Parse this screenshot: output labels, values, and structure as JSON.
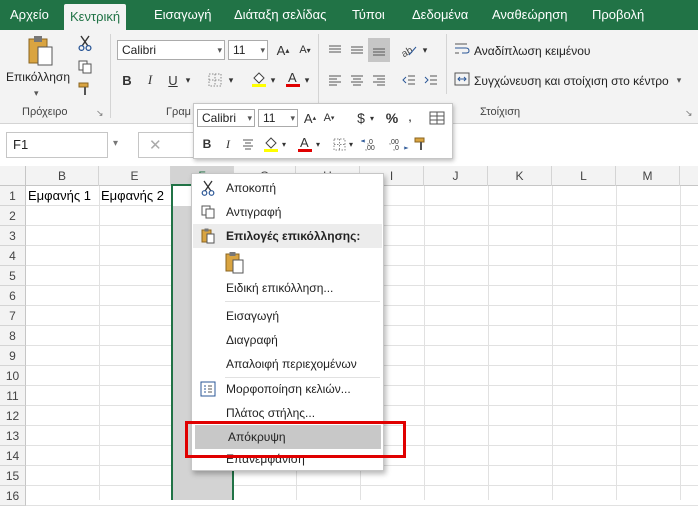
{
  "tabs": [
    "Αρχείο",
    "Κεντρική",
    "Εισαγωγή",
    "Διάταξη σελίδας",
    "Τύποι",
    "Δεδομένα",
    "Αναθεώρηση",
    "Προβολή"
  ],
  "ribbon": {
    "paste_label": "Επικόλληση",
    "clipboard_label": "Πρόχειρο",
    "font_name": "Calibri",
    "font_size": "11",
    "bold": "B",
    "italic": "I",
    "underline": "U",
    "font_group_label": "Γραμ",
    "wrap_text": "Αναδίπλωση κειμένου",
    "merge_center": "Συγχώνευση και στοίχιση στο κέντρο",
    "alignment_label": "Στοίχιση"
  },
  "formula_bar": {
    "name_box": "F1"
  },
  "columns": [
    "B",
    "E",
    "F",
    "G",
    "H",
    "I",
    "J",
    "K",
    "L",
    "M"
  ],
  "rows": [
    "1",
    "2",
    "3",
    "4",
    "5",
    "6",
    "7",
    "8",
    "9",
    "10",
    "11",
    "12",
    "13",
    "14",
    "15",
    "16"
  ],
  "cells": {
    "B1": "Εμφανής 1",
    "E1": "Εμφανής 2"
  },
  "mini_toolbar": {
    "font_name": "Calibri",
    "font_size": "11",
    "bold": "B",
    "italic": "I",
    "currency": "$",
    "percent": "%",
    "dec_inc": "←,0 .00",
    "dec_dec": ",00 →,0"
  },
  "context_menu": {
    "cut": "Αποκοπή",
    "copy": "Αντιγραφή",
    "paste_options": "Επιλογές επικόλλησης:",
    "paste_special": "Ειδική επικόλληση...",
    "insert": "Εισαγωγή",
    "delete": "Διαγραφή",
    "clear_contents": "Απαλοιφή περιεχομένων",
    "format_cells": "Μορφοποίηση κελιών...",
    "column_width": "Πλάτος στήλης...",
    "hide": "Απόκρυψη",
    "unhide": "Επανεμφάνιση"
  },
  "colors": {
    "excel_green": "#217346",
    "highlight_red": "#e00000",
    "font_red": "#e00000",
    "fill_yellow": "#ffff00"
  }
}
